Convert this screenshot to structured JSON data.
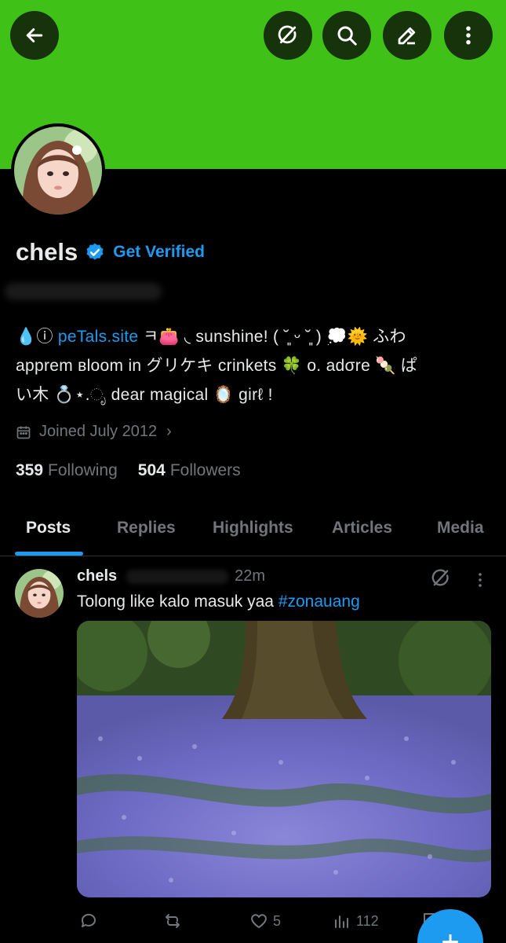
{
  "header": {
    "back_icon": "arrow-left-icon",
    "actions": [
      "grok-icon",
      "search-icon",
      "edit-icon",
      "more-vertical-icon"
    ],
    "banner_color": "#3fc117"
  },
  "profile": {
    "name": "chels",
    "get_verified": "Get Verified",
    "bio_prefix": "💧ⓘ ",
    "bio_link": "peTals.site",
    "bio_line1_rest": " ㅋ👛 ◟ sunshine! ( ˘͈ ᵕ ˘͈ ) 💭🌞 ふわ",
    "bio_line2": "apprem ʙloom in グリケキ crinkets 🍀 o. adσre 🍡 ぱ",
    "bio_line3": "い木 💍⋆.ೃ dear magical 🪞 girℓ !",
    "joined": "Joined July 2012",
    "following_count": "359",
    "following_label": "Following",
    "followers_count": "504",
    "followers_label": "Followers"
  },
  "tabs": [
    "Posts",
    "Replies",
    "Highlights",
    "Articles",
    "Media"
  ],
  "active_tab": "Posts",
  "post": {
    "name": "chels",
    "time": "22m",
    "text": "Tolong like kalo masuk yaa ",
    "hashtag": "#zonauang",
    "likes": "5",
    "views": "112"
  },
  "colors": {
    "accent": "#1d9bf0",
    "muted": "#71767b",
    "text": "#e7e9ea"
  }
}
